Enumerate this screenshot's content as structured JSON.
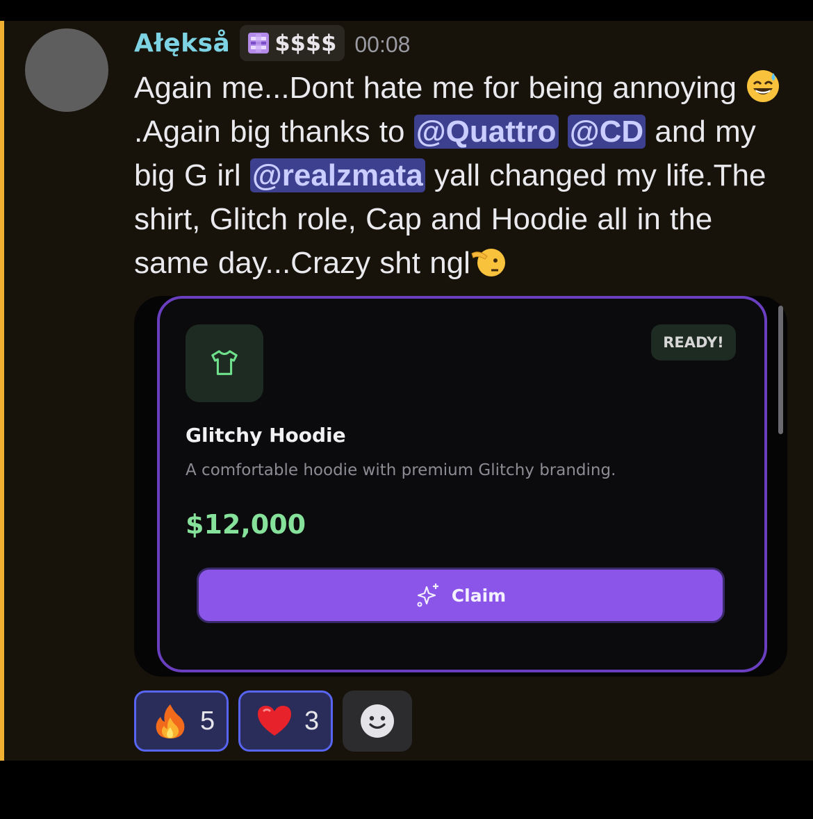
{
  "message": {
    "author": "Ałękså",
    "role_tag": "$$$$",
    "timestamp": "00:08",
    "text": {
      "part1": "Again me...Dont hate me for being annoying ",
      "part2": ".Again big thanks to ",
      "mention1": "@Quattro",
      "mention2": "@CD",
      "part3": " and my big G irl ",
      "mention3": "@realzmata",
      "part4": " yall changed my life.The shirt, Glitch role, Cap and Hoodie all in the same day...Crazy sht ngl"
    }
  },
  "embed": {
    "badge": "READY!",
    "title": "Glitchy Hoodie",
    "description": "A comfortable hoodie with premium Glitchy branding.",
    "price": "$12,000",
    "claim_label": "Claim",
    "icon": "shirt-icon"
  },
  "reactions": [
    {
      "emoji": "fire",
      "count": "5"
    },
    {
      "emoji": "heart",
      "count": "3"
    }
  ],
  "colors": {
    "highlight": "#f0b132",
    "username": "#7dd3e3",
    "mention_bg": "#3d3f8f",
    "embed_border": "#6a3fbf",
    "price": "#86e29a",
    "claim_button": "#8b55ea",
    "reaction_border": "#5865f2"
  }
}
